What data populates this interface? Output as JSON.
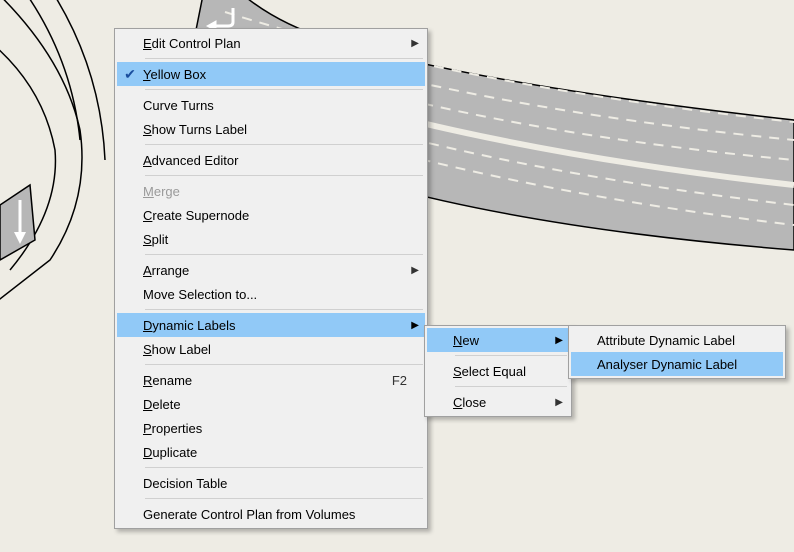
{
  "menu1": {
    "edit_control_plan": "Edit Control Plan",
    "yellow_box": "Yellow Box",
    "curve_turns": "Curve Turns",
    "show_turns_label": "Show Turns Label",
    "advanced_editor": "Advanced Editor",
    "merge": "Merge",
    "create_supernode": "Create Supernode",
    "split": "Split",
    "arrange": "Arrange",
    "move_selection_to": "Move Selection to...",
    "dynamic_labels": "Dynamic Labels",
    "show_label": "Show Label",
    "rename": "Rename",
    "rename_shortcut": "F2",
    "delete": "Delete",
    "properties": "Properties",
    "duplicate": "Duplicate",
    "decision_table": "Decision Table",
    "generate_control_plan": "Generate Control Plan from Volumes"
  },
  "menu2": {
    "new": "New",
    "select_equal": "Select Equal",
    "close": "Close"
  },
  "menu3": {
    "attribute_dynamic_label": "Attribute Dynamic Label",
    "analyser_dynamic_label": "Analyser Dynamic Label"
  }
}
